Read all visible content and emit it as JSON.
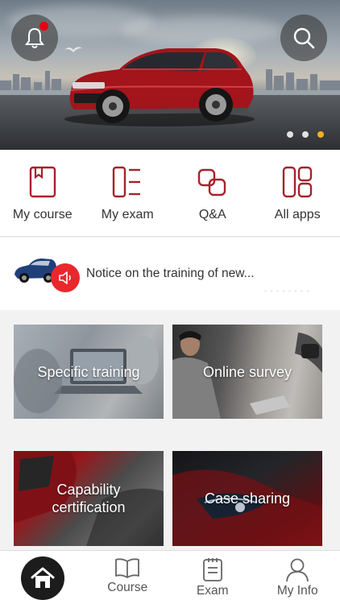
{
  "colors": {
    "accent_red": "#a8222a",
    "notice_red": "#e8282c",
    "badge_red": "#e60012",
    "active_dot": "#f0b020",
    "tab_icon": "#666666"
  },
  "banner": {
    "carousel_count": 3,
    "active_index": 2
  },
  "quick_entries": [
    {
      "label": "My course",
      "icon": "book-icon"
    },
    {
      "label": "My exam",
      "icon": "exam-list-icon"
    },
    {
      "label": "Q&A",
      "icon": "qa-squares-icon"
    },
    {
      "label": "All apps",
      "icon": "grid-apps-icon"
    }
  ],
  "notice": {
    "text": "Notice on the training of new...",
    "date": "- - - -   - - - -"
  },
  "tiles": [
    {
      "label": "Specific training"
    },
    {
      "label": "Online survey"
    },
    {
      "label": "Capability certification"
    },
    {
      "label": "Case sharing"
    }
  ],
  "tabbar": {
    "home": {
      "label": "",
      "icon": "home-icon"
    },
    "course": {
      "label": "Course",
      "icon": "open-book-icon"
    },
    "exam": {
      "label": "Exam",
      "icon": "clipboard-icon"
    },
    "myinfo": {
      "label": "My Info",
      "icon": "user-icon"
    }
  }
}
